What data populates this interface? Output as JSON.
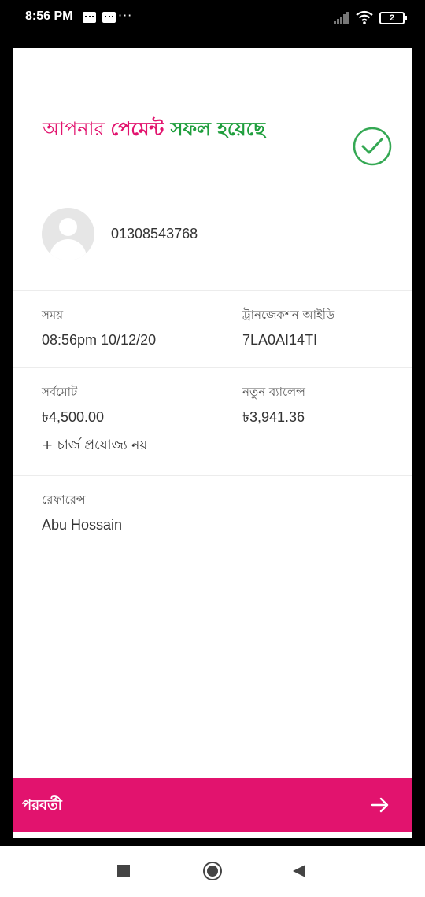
{
  "status_bar": {
    "time": "8:56 PM",
    "dots": "···",
    "battery": "2"
  },
  "headline": {
    "part1": "আপনার ",
    "part2": "পেমেন্ট ",
    "part3": "সফল হয়েছে"
  },
  "account": {
    "phone": "01308543768"
  },
  "details": {
    "time_label": "সময়",
    "time_value": "08:56pm 10/12/20",
    "trx_label": "ট্রানজেকশন আইডি",
    "trx_value": "7LA0AI14TI",
    "total_label": "সর্বমোট",
    "total_value": "৳4,500.00",
    "charge_note": "+ চার্জ প্রযোজ্য নয়",
    "balance_label": "নতুন ব্যালেন্স",
    "balance_value": "৳3,941.36",
    "reference_label": "রেফারেন্স",
    "reference_value": "Abu Hossain"
  },
  "next_button": {
    "label": "পরবর্তী"
  },
  "colors": {
    "brand": "#e2136e",
    "success": "#1e9e3c"
  }
}
